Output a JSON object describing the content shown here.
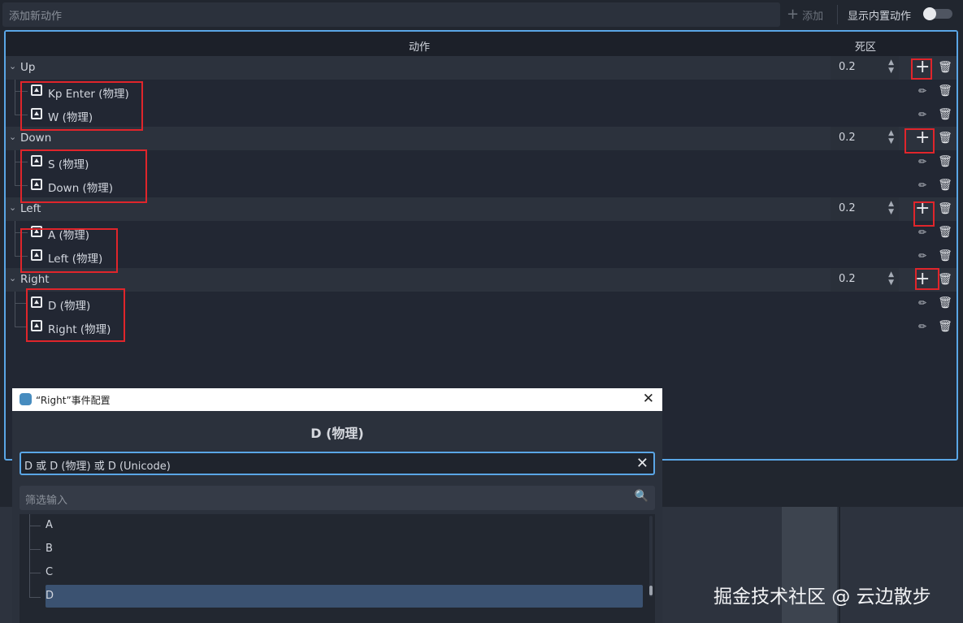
{
  "topbar": {
    "add_placeholder": "添加新动作",
    "add_button": "添加",
    "builtin_label": "显示内置动作"
  },
  "table": {
    "col_action": "动作",
    "col_deadzone": "死区"
  },
  "actions": [
    {
      "name": "Up",
      "deadzone": "0.2",
      "events": [
        "Kp Enter (物理)",
        "W (物理)"
      ]
    },
    {
      "name": "Down",
      "deadzone": "0.2",
      "events": [
        "S (物理)",
        "Down (物理)"
      ]
    },
    {
      "name": "Left",
      "deadzone": "0.2",
      "events": [
        "A (物理)",
        "Left (物理)"
      ]
    },
    {
      "name": "Right",
      "deadzone": "0.2",
      "events": [
        "D (物理)",
        "Right (物理)"
      ]
    }
  ],
  "dialog": {
    "title": "“Right”事件配置",
    "heading": "D (物理)",
    "listen_value": "D 或 D (物理) 或 D (Unicode)",
    "filter_placeholder": "筛选输入",
    "keys": [
      "A",
      "B",
      "C",
      "D"
    ],
    "selected_key": "D"
  },
  "watermark": "掘金技术社区 @ 云边散步",
  "colors": {
    "accent": "#5aa6e6",
    "highlight_box": "#e0252b",
    "selected_row": "#3b5271"
  },
  "icons": {
    "add": "plus-icon",
    "edit": "pencil-icon",
    "delete": "trash-icon",
    "event": "keyboard-icon",
    "search": "search-icon",
    "close": "close-icon"
  }
}
